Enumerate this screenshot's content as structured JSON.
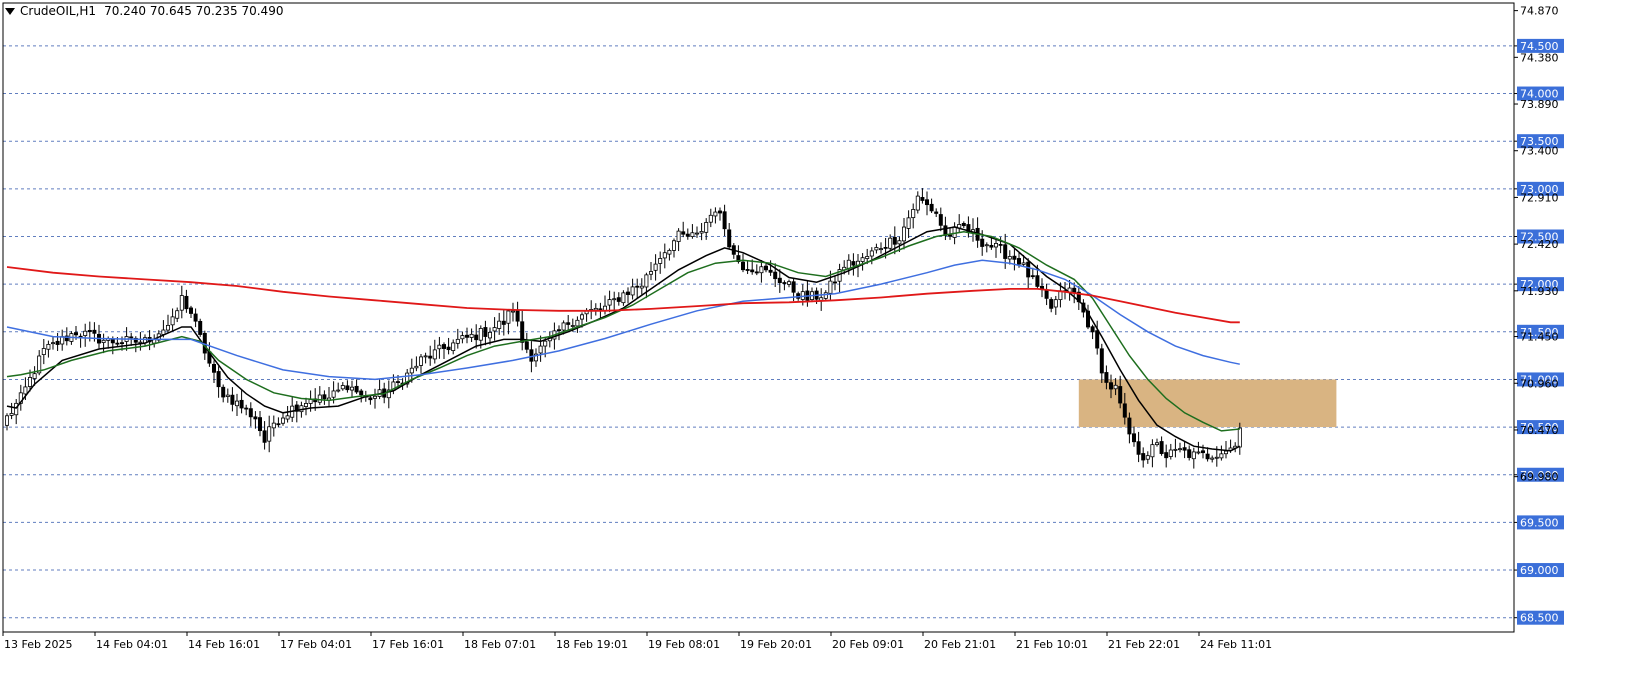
{
  "header": {
    "symbol": "CrudeOIL,H1",
    "ohlc": "70.240 70.645 70.235 70.490"
  },
  "colors": {
    "background": "#ffffff",
    "grid": "#3a5fb0",
    "bull_body": "#ffffff",
    "bear_body": "#000000",
    "ma_black": "#000000",
    "ma_green": "#1e6e1e",
    "ma_blue": "#3f6fe0",
    "ma_red": "#e01818",
    "zone_fill": "#d9b482",
    "label_box": "#3b6fd9",
    "label_text": "#ffffff"
  },
  "chart_data": {
    "type": "candlestick",
    "symbol": "CrudeOIL",
    "timeframe": "H1",
    "ylim": [
      68.35,
      74.95
    ],
    "grid_levels": [
      74.5,
      74.0,
      73.5,
      73.0,
      72.5,
      72.0,
      71.5,
      71.0,
      70.5,
      70.0,
      69.5,
      69.0,
      68.5
    ],
    "price_labels": [
      {
        "text": "74.870",
        "value": 74.87,
        "boxed": false
      },
      {
        "text": "74.500",
        "value": 74.5,
        "boxed": true
      },
      {
        "text": "74.380",
        "value": 74.38,
        "boxed": false
      },
      {
        "text": "74.000",
        "value": 74.0,
        "boxed": true
      },
      {
        "text": "73.890",
        "value": 73.89,
        "boxed": false
      },
      {
        "text": "73.500",
        "value": 73.5,
        "boxed": true
      },
      {
        "text": "73.400",
        "value": 73.4,
        "boxed": false
      },
      {
        "text": "73.000",
        "value": 73.0,
        "boxed": true
      },
      {
        "text": "72.910",
        "value": 72.91,
        "boxed": false
      },
      {
        "text": "72.500",
        "value": 72.5,
        "boxed": true
      },
      {
        "text": "72.420",
        "value": 72.42,
        "boxed": false
      },
      {
        "text": "72.000",
        "value": 72.0,
        "boxed": true
      },
      {
        "text": "71.930",
        "value": 71.93,
        "boxed": false
      },
      {
        "text": "71.500",
        "value": 71.5,
        "boxed": true
      },
      {
        "text": "71.450",
        "value": 71.45,
        "boxed": false
      },
      {
        "text": "71.000",
        "value": 71.0,
        "boxed": true
      },
      {
        "text": "70.960",
        "value": 70.96,
        "boxed": false
      },
      {
        "text": "70.500",
        "value": 70.5,
        "boxed": true
      },
      {
        "text": "70.470",
        "value": 70.47,
        "boxed": false
      },
      {
        "text": "70.000",
        "value": 70.0,
        "boxed": true
      },
      {
        "text": "69.980",
        "value": 69.98,
        "boxed": false
      },
      {
        "text": "69.500",
        "value": 69.5,
        "boxed": true
      },
      {
        "text": "69.000",
        "value": 69.0,
        "boxed": true
      },
      {
        "text": "68.500",
        "value": 68.5,
        "boxed": true
      }
    ],
    "time_labels": [
      {
        "text": "13 Feb 2025",
        "bar": 0
      },
      {
        "text": "14 Feb 04:01",
        "bar": 20
      },
      {
        "text": "14 Feb 16:01",
        "bar": 40
      },
      {
        "text": "17 Feb 04:01",
        "bar": 60
      },
      {
        "text": "17 Feb 16:01",
        "bar": 80
      },
      {
        "text": "18 Feb 07:01",
        "bar": 100
      },
      {
        "text": "18 Feb 19:01",
        "bar": 120
      },
      {
        "text": "19 Feb 08:01",
        "bar": 140
      },
      {
        "text": "19 Feb 20:01",
        "bar": 160
      },
      {
        "text": "20 Feb 09:01",
        "bar": 180
      },
      {
        "text": "20 Feb 21:01",
        "bar": 200
      },
      {
        "text": "21 Feb 10:01",
        "bar": 220
      },
      {
        "text": "21 Feb 22:01",
        "bar": 240
      },
      {
        "text": "24 Feb 11:01",
        "bar": 260
      }
    ],
    "zone": {
      "bar_start": 233,
      "bar_end": 289,
      "price_low": 70.5,
      "price_high": 71.0
    },
    "key_points": [
      [
        0,
        70.6
      ],
      [
        3,
        70.8
      ],
      [
        8,
        71.3
      ],
      [
        15,
        71.5
      ],
      [
        22,
        71.4
      ],
      [
        30,
        71.4
      ],
      [
        36,
        71.6
      ],
      [
        38,
        71.85
      ],
      [
        40,
        71.7
      ],
      [
        43,
        71.3
      ],
      [
        46,
        70.9
      ],
      [
        50,
        70.75
      ],
      [
        54,
        70.6
      ],
      [
        56,
        70.35
      ],
      [
        58,
        70.55
      ],
      [
        62,
        70.7
      ],
      [
        66,
        70.8
      ],
      [
        70,
        70.8
      ],
      [
        74,
        70.95
      ],
      [
        78,
        70.8
      ],
      [
        82,
        70.85
      ],
      [
        86,
        71.0
      ],
      [
        90,
        71.2
      ],
      [
        94,
        71.3
      ],
      [
        98,
        71.4
      ],
      [
        104,
        71.5
      ],
      [
        108,
        71.6
      ],
      [
        110,
        71.75
      ],
      [
        112,
        71.4
      ],
      [
        114,
        71.25
      ],
      [
        118,
        71.4
      ],
      [
        122,
        71.6
      ],
      [
        126,
        71.7
      ],
      [
        130,
        71.75
      ],
      [
        134,
        71.9
      ],
      [
        138,
        72.0
      ],
      [
        142,
        72.3
      ],
      [
        146,
        72.5
      ],
      [
        150,
        72.5
      ],
      [
        154,
        72.8
      ],
      [
        156,
        72.6
      ],
      [
        158,
        72.3
      ],
      [
        160,
        72.2
      ],
      [
        164,
        72.15
      ],
      [
        168,
        72.05
      ],
      [
        172,
        71.9
      ],
      [
        174,
        71.85
      ],
      [
        178,
        71.9
      ],
      [
        182,
        72.2
      ],
      [
        186,
        72.25
      ],
      [
        190,
        72.4
      ],
      [
        194,
        72.5
      ],
      [
        198,
        72.9
      ],
      [
        202,
        72.75
      ],
      [
        204,
        72.5
      ],
      [
        208,
        72.6
      ],
      [
        212,
        72.45
      ],
      [
        216,
        72.35
      ],
      [
        220,
        72.25
      ],
      [
        224,
        71.95
      ],
      [
        227,
        71.75
      ],
      [
        230,
        71.95
      ],
      [
        232,
        71.9
      ],
      [
        235,
        71.6
      ],
      [
        237,
        71.3
      ],
      [
        239,
        70.95
      ],
      [
        241,
        70.9
      ],
      [
        243,
        70.55
      ],
      [
        245,
        70.3
      ],
      [
        247,
        70.2
      ],
      [
        250,
        70.3
      ],
      [
        252,
        70.2
      ],
      [
        255,
        70.25
      ],
      [
        258,
        70.2
      ],
      [
        261,
        70.2
      ],
      [
        264,
        70.25
      ],
      [
        267,
        70.3
      ],
      [
        268,
        70.49
      ]
    ],
    "series": [
      {
        "type": "sma",
        "color": "#000000",
        "period": 8,
        "points": [
          [
            0,
            70.72
          ],
          [
            2,
            70.7
          ],
          [
            6,
            70.95
          ],
          [
            12,
            71.2
          ],
          [
            20,
            71.32
          ],
          [
            30,
            71.38
          ],
          [
            38,
            71.55
          ],
          [
            40,
            71.55
          ],
          [
            44,
            71.28
          ],
          [
            48,
            71.02
          ],
          [
            52,
            70.85
          ],
          [
            56,
            70.72
          ],
          [
            60,
            70.65
          ],
          [
            66,
            70.7
          ],
          [
            72,
            70.72
          ],
          [
            78,
            70.82
          ],
          [
            84,
            70.88
          ],
          [
            90,
            71.05
          ],
          [
            96,
            71.2
          ],
          [
            102,
            71.35
          ],
          [
            108,
            71.42
          ],
          [
            112,
            71.42
          ],
          [
            116,
            71.4
          ],
          [
            122,
            71.5
          ],
          [
            128,
            71.62
          ],
          [
            134,
            71.75
          ],
          [
            140,
            71.95
          ],
          [
            146,
            72.15
          ],
          [
            152,
            72.3
          ],
          [
            156,
            72.38
          ],
          [
            160,
            72.33
          ],
          [
            166,
            72.2
          ],
          [
            170,
            72.07
          ],
          [
            176,
            72.02
          ],
          [
            182,
            72.12
          ],
          [
            188,
            72.25
          ],
          [
            194,
            72.4
          ],
          [
            200,
            72.55
          ],
          [
            206,
            72.6
          ],
          [
            212,
            72.52
          ],
          [
            218,
            72.42
          ],
          [
            222,
            72.25
          ],
          [
            226,
            72.08
          ],
          [
            230,
            71.95
          ],
          [
            234,
            71.78
          ],
          [
            238,
            71.45
          ],
          [
            242,
            71.1
          ],
          [
            246,
            70.78
          ],
          [
            250,
            70.52
          ],
          [
            254,
            70.4
          ],
          [
            258,
            70.3
          ],
          [
            262,
            70.27
          ],
          [
            266,
            70.25
          ],
          [
            268,
            70.3
          ]
        ]
      },
      {
        "type": "sma",
        "color": "#1e6e1e",
        "period": 13,
        "points": [
          [
            0,
            71.03
          ],
          [
            3,
            71.05
          ],
          [
            8,
            71.1
          ],
          [
            14,
            71.2
          ],
          [
            22,
            71.3
          ],
          [
            30,
            71.35
          ],
          [
            38,
            71.45
          ],
          [
            42,
            71.4
          ],
          [
            46,
            71.2
          ],
          [
            52,
            71.0
          ],
          [
            58,
            70.86
          ],
          [
            64,
            70.8
          ],
          [
            70,
            70.78
          ],
          [
            76,
            70.82
          ],
          [
            82,
            70.85
          ],
          [
            88,
            71.0
          ],
          [
            94,
            71.12
          ],
          [
            100,
            71.25
          ],
          [
            106,
            71.35
          ],
          [
            112,
            71.4
          ],
          [
            118,
            71.45
          ],
          [
            124,
            71.55
          ],
          [
            130,
            71.65
          ],
          [
            136,
            71.78
          ],
          [
            142,
            71.95
          ],
          [
            148,
            72.12
          ],
          [
            154,
            72.22
          ],
          [
            160,
            72.25
          ],
          [
            166,
            72.22
          ],
          [
            172,
            72.12
          ],
          [
            178,
            72.08
          ],
          [
            184,
            72.18
          ],
          [
            190,
            72.28
          ],
          [
            196,
            72.4
          ],
          [
            202,
            72.5
          ],
          [
            208,
            72.55
          ],
          [
            214,
            72.5
          ],
          [
            220,
            72.38
          ],
          [
            226,
            72.2
          ],
          [
            232,
            72.05
          ],
          [
            236,
            71.85
          ],
          [
            240,
            71.55
          ],
          [
            244,
            71.25
          ],
          [
            248,
            71.0
          ],
          [
            252,
            70.8
          ],
          [
            256,
            70.65
          ],
          [
            260,
            70.55
          ],
          [
            264,
            70.46
          ],
          [
            268,
            70.48
          ]
        ]
      },
      {
        "type": "sma",
        "color": "#3f6fe0",
        "period": 50,
        "points": [
          [
            0,
            71.55
          ],
          [
            10,
            71.45
          ],
          [
            20,
            71.43
          ],
          [
            30,
            71.42
          ],
          [
            40,
            71.42
          ],
          [
            50,
            71.25
          ],
          [
            60,
            71.1
          ],
          [
            70,
            71.03
          ],
          [
            80,
            71.0
          ],
          [
            90,
            71.05
          ],
          [
            100,
            71.12
          ],
          [
            110,
            71.2
          ],
          [
            120,
            71.3
          ],
          [
            130,
            71.43
          ],
          [
            140,
            71.58
          ],
          [
            150,
            71.72
          ],
          [
            160,
            71.82
          ],
          [
            170,
            71.86
          ],
          [
            180,
            71.9
          ],
          [
            190,
            72.0
          ],
          [
            200,
            72.12
          ],
          [
            206,
            72.2
          ],
          [
            212,
            72.25
          ],
          [
            218,
            72.22
          ],
          [
            224,
            72.15
          ],
          [
            230,
            72.05
          ],
          [
            236,
            71.88
          ],
          [
            242,
            71.68
          ],
          [
            248,
            71.5
          ],
          [
            254,
            71.35
          ],
          [
            260,
            71.25
          ],
          [
            266,
            71.18
          ],
          [
            268,
            71.16
          ]
        ]
      },
      {
        "type": "sma",
        "color": "#e01818",
        "period": 200,
        "points": [
          [
            0,
            72.18
          ],
          [
            10,
            72.12
          ],
          [
            20,
            72.08
          ],
          [
            30,
            72.05
          ],
          [
            40,
            72.02
          ],
          [
            50,
            71.98
          ],
          [
            60,
            71.92
          ],
          [
            70,
            71.87
          ],
          [
            80,
            71.83
          ],
          [
            90,
            71.79
          ],
          [
            100,
            71.75
          ],
          [
            110,
            71.73
          ],
          [
            120,
            71.72
          ],
          [
            130,
            71.72
          ],
          [
            140,
            71.74
          ],
          [
            150,
            71.77
          ],
          [
            160,
            71.8
          ],
          [
            170,
            71.81
          ],
          [
            180,
            71.83
          ],
          [
            190,
            71.86
          ],
          [
            200,
            71.9
          ],
          [
            210,
            71.93
          ],
          [
            218,
            71.95
          ],
          [
            224,
            71.95
          ],
          [
            230,
            71.92
          ],
          [
            236,
            71.88
          ],
          [
            242,
            71.82
          ],
          [
            248,
            71.76
          ],
          [
            254,
            71.7
          ],
          [
            260,
            71.65
          ],
          [
            266,
            71.6
          ],
          [
            268,
            71.6
          ]
        ]
      }
    ]
  }
}
